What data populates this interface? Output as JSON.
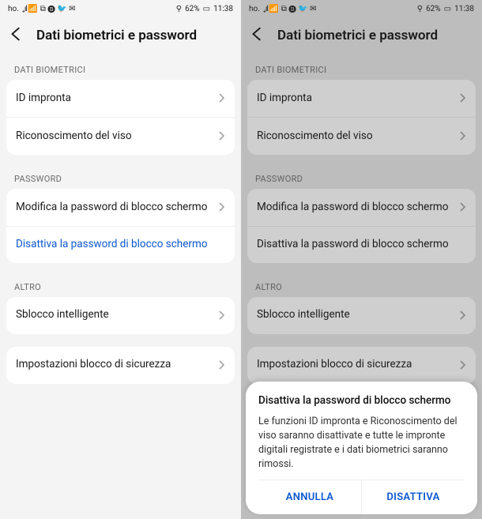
{
  "status": {
    "carrier": "ho.",
    "signal": "₊ıl 📶",
    "icons": "⧉ 🅑 🐦 ✉",
    "bt": "⚲",
    "battery_pct": "62%",
    "time": "11:38"
  },
  "page": {
    "title": "Dati biometrici e password"
  },
  "sections": {
    "biometrici": {
      "header": "DATI BIOMETRICI",
      "items": [
        {
          "label": "ID impronta"
        },
        {
          "label": "Riconoscimento del viso"
        }
      ]
    },
    "password": {
      "header": "PASSWORD",
      "items": [
        {
          "label": "Modifica la password di blocco schermo"
        },
        {
          "label": "Disattiva la password di blocco schermo"
        }
      ]
    },
    "altro": {
      "header": "ALTRO",
      "items": [
        {
          "label": "Sblocco intelligente"
        }
      ],
      "items2": [
        {
          "label": "Impostazioni blocco di sicurezza"
        }
      ]
    }
  },
  "dialog": {
    "title": "Disattiva la password di blocco schermo",
    "message": "Le funzioni ID impronta e Riconoscimento del viso saranno disattivate e tutte le impronte digitali registrate e i dati biometrici saranno rimossi.",
    "cancel": "ANNULLA",
    "confirm": "DISATTIVA"
  },
  "colors": {
    "accent": "#0b57d0"
  }
}
